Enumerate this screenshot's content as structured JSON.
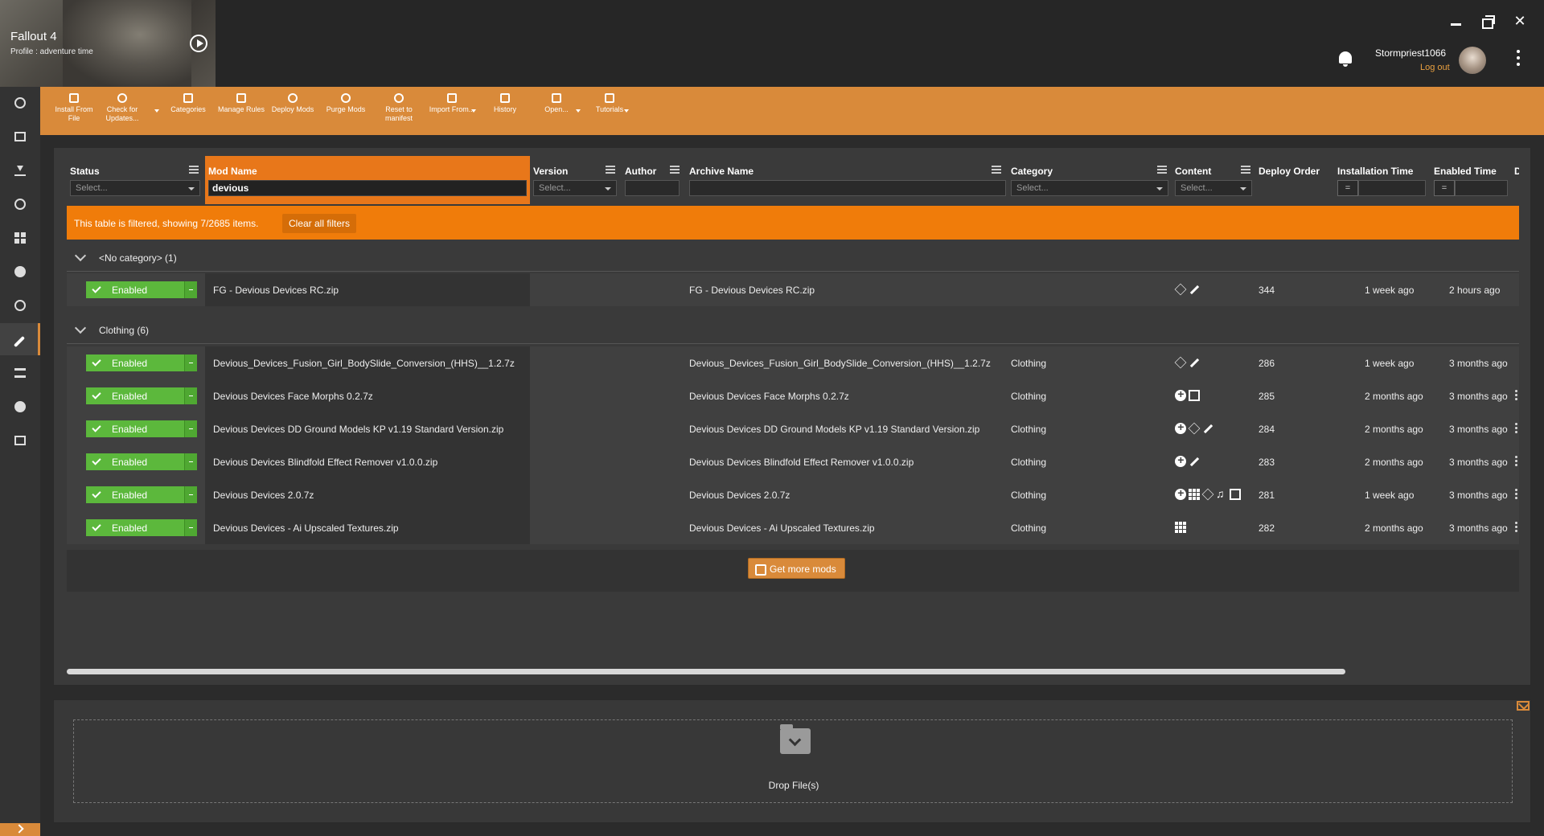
{
  "game": {
    "title": "Fallout 4",
    "profile": "Profile : adventure time"
  },
  "user": {
    "name": "Stormpriest1066",
    "logout": "Log out"
  },
  "toolbar": [
    {
      "label": "Install From File"
    },
    {
      "label": "Check for Updates..."
    },
    {
      "label": "Categories"
    },
    {
      "label": "Manage Rules"
    },
    {
      "label": "Deploy Mods"
    },
    {
      "label": "Purge Mods"
    },
    {
      "label": "Reset to manifest"
    },
    {
      "label": "Import From..."
    },
    {
      "label": "History"
    },
    {
      "label": "Open..."
    },
    {
      "label": "Tutorials"
    }
  ],
  "columns": {
    "status": "Status",
    "mod_name": "Mod Name",
    "version": "Version",
    "author": "Author",
    "archive_name": "Archive Name",
    "category": "Category",
    "content": "Content",
    "deploy_order": "Deploy Order",
    "installation_time": "Installation Time",
    "enabled_time": "Enabled Time",
    "cut_off": "D"
  },
  "filters": {
    "select_placeholder": "Select...",
    "mod_name_value": "devious",
    "eq": "="
  },
  "filter_bar": {
    "message": "This table is filtered, showing 7/2685 items.",
    "clear": "Clear all filters"
  },
  "groups": [
    {
      "title": "<No category> (1)",
      "rows": [
        {
          "status": "Enabled",
          "name": "FG - Devious Devices RC.zip",
          "archive": "FG - Devious Devices RC.zip",
          "category": "",
          "icons": [
            "box-icon",
            "wrench-icon"
          ],
          "deploy": "344",
          "installed": "1 week ago",
          "enabled": "2 hours ago"
        }
      ]
    },
    {
      "title": "Clothing (6)",
      "rows": [
        {
          "status": "Enabled",
          "name": "Devious_Devices_Fusion_Girl_BodySlide_Conversion_(HHS)__1.2.7z",
          "archive": "Devious_Devices_Fusion_Girl_BodySlide_Conversion_(HHS)__1.2.7z",
          "category": "Clothing",
          "icons": [
            "box-icon",
            "wrench-icon"
          ],
          "deploy": "286",
          "installed": "1 week ago",
          "enabled": "3 months ago"
        },
        {
          "status": "Enabled",
          "name": "Devious Devices Face Morphs 0.2.7z",
          "archive": "Devious Devices Face Morphs 0.2.7z",
          "category": "Clothing",
          "icons": [
            "plugin-icon",
            "document-icon"
          ],
          "deploy": "285",
          "installed": "2 months ago",
          "enabled": "3 months ago"
        },
        {
          "status": "Enabled",
          "name": "Devious Devices DD Ground Models KP v1.19 Standard Version.zip",
          "archive": "Devious Devices DD Ground Models KP v1.19 Standard Version.zip",
          "category": "Clothing",
          "icons": [
            "plugin-icon",
            "box-icon",
            "wrench-icon"
          ],
          "deploy": "284",
          "installed": "2 months ago",
          "enabled": "3 months ago"
        },
        {
          "status": "Enabled",
          "name": "Devious Devices Blindfold Effect Remover v1.0.0.zip",
          "archive": "Devious Devices Blindfold Effect Remover v1.0.0.zip",
          "category": "Clothing",
          "icons": [
            "plugin-icon",
            "wrench-icon"
          ],
          "deploy": "283",
          "installed": "2 months ago",
          "enabled": "3 months ago"
        },
        {
          "status": "Enabled",
          "name": "Devious Devices 2.0.7z",
          "archive": "Devious Devices 2.0.7z",
          "category": "Clothing",
          "icons": [
            "plugin-icon",
            "grid-icon",
            "box-icon",
            "music-icon",
            "document-icon"
          ],
          "deploy": "281",
          "installed": "1 week ago",
          "enabled": "3 months ago"
        },
        {
          "status": "Enabled",
          "name": "Devious Devices - Ai Upscaled Textures.zip",
          "archive": "Devious Devices - Ai Upscaled Textures.zip",
          "category": "Clothing",
          "icons": [
            "grid-icon"
          ],
          "deploy": "282",
          "installed": "2 months ago",
          "enabled": "3 months ago"
        }
      ]
    }
  ],
  "get_more_mods": "Get more mods",
  "drop_zone": {
    "label": "Drop File(s)"
  },
  "colors": {
    "accent": "#d98a3a",
    "filter_bar": "#f07c0a",
    "enabled": "#5cb83c"
  }
}
